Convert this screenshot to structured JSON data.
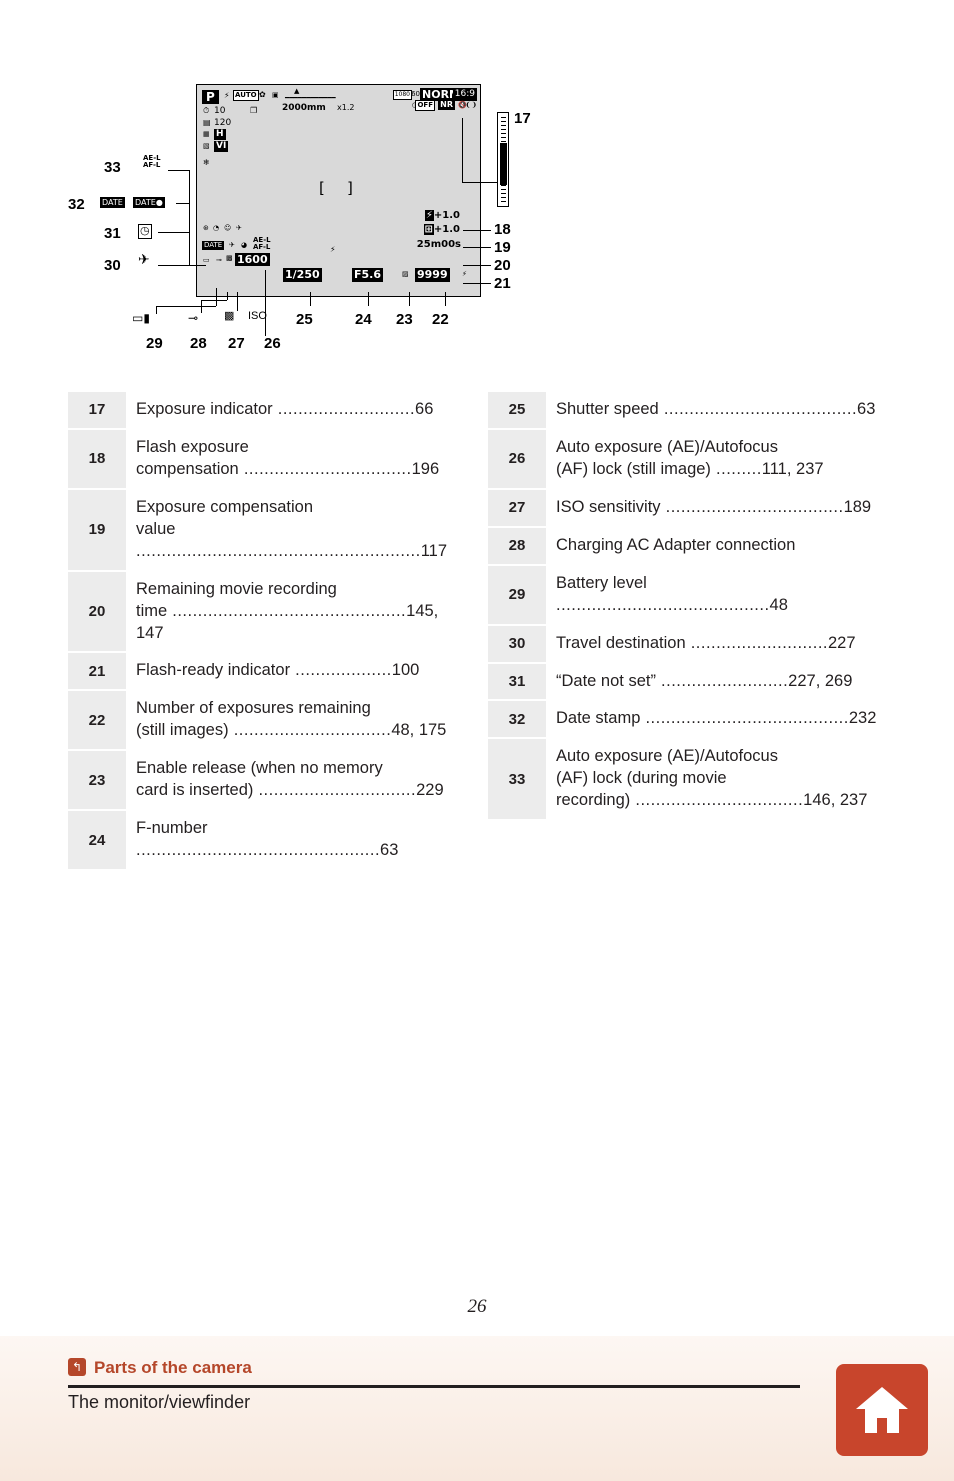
{
  "page": {
    "number": "26",
    "footer_section": "Parts of the camera",
    "footer_subsection": "The monitor/viewfinder",
    "home_icon": "home-icon",
    "back_icon": "back-arrow-icon"
  },
  "diagram": {
    "name": "camera-monitor-display-diagram",
    "callouts_right": [
      "17",
      "18",
      "19",
      "20",
      "21"
    ],
    "callouts_left": [
      "33",
      "32",
      "31",
      "30"
    ],
    "callouts_bottom": [
      "29",
      "28",
      "27",
      "26",
      "25",
      "24",
      "23",
      "22"
    ],
    "display": {
      "mode": "P",
      "flash_mode": "AUTO",
      "self_timer": "10",
      "continuous": "120",
      "hdr": "H",
      "vr": "VI",
      "zoom_focal": "2000mm",
      "zoom_digital": "x1.2",
      "image_quality": "NORM",
      "image_size_icon": "16:9",
      "movie_quality": "1080",
      "frame_rate": "60",
      "noise_reduction": "NR",
      "wind_noise": "OFF",
      "flash_comp": "+1.0",
      "exposure_comp": "+1.0",
      "movie_time": "25m00s",
      "iso_value": "1600",
      "shutter_speed": "1/250",
      "f_number": "F5.6",
      "frames_remaining": "9999",
      "date_stamp": "DATE",
      "ae_af_lock": "AE-L AF-L",
      "battery_icon": "battery-icon",
      "ac_adapter_icon": "ac-adapter-icon",
      "iso_label": "ISO",
      "focus_brackets": "[ ]"
    }
  },
  "legend": {
    "left": [
      {
        "num": "17",
        "text": "Exposure indicator",
        "dots": " ...........................",
        "pages": "66"
      },
      {
        "num": "18",
        "text": "Flash exposure\ncompensation",
        "dots": " .................................",
        "pages": "196"
      },
      {
        "num": "19",
        "text": "Exposure compensation\nvalue",
        "dots": " ........................................................",
        "pages": "117"
      },
      {
        "num": "20",
        "text": "Remaining movie recording\ntime",
        "dots": " ..............................................",
        "pages": "145, 147"
      },
      {
        "num": "21",
        "text": "Flash-ready indicator",
        "dots": " ...................",
        "pages": "100"
      },
      {
        "num": "22",
        "text": "Number of exposures remaining\n(still images)",
        "dots": " ...............................",
        "pages": "48, 175"
      },
      {
        "num": "23",
        "text": "Enable release (when no memory\ncard is inserted)",
        "dots": " ...............................",
        "pages": "229"
      },
      {
        "num": "24",
        "text": "F-number",
        "dots": " ................................................",
        "pages": "63"
      }
    ],
    "right": [
      {
        "num": "25",
        "text": "Shutter speed",
        "dots": " ......................................",
        "pages": "63"
      },
      {
        "num": "26",
        "text": "Auto exposure (AE)/Autofocus\n(AF) lock (still image)",
        "dots": " .........",
        "pages": "111, 237"
      },
      {
        "num": "27",
        "text": "ISO sensitivity",
        "dots": " ...................................",
        "pages": "189"
      },
      {
        "num": "28",
        "text": "Charging AC Adapter connection",
        "dots": "",
        "pages": ""
      },
      {
        "num": "29",
        "text": "Battery level",
        "dots": " ..........................................",
        "pages": "48"
      },
      {
        "num": "30",
        "text": "Travel destination",
        "dots": " ...........................",
        "pages": "227"
      },
      {
        "num": "31",
        "text": "“Date not set”",
        "dots": " .........................",
        "pages": "227, 269"
      },
      {
        "num": "32",
        "text": "Date stamp",
        "dots": " ........................................",
        "pages": "232"
      },
      {
        "num": "33",
        "text": "Auto exposure (AE)/Autofocus\n(AF) lock (during movie\nrecording)",
        "dots": " .................................",
        "pages": "146, 237"
      }
    ]
  },
  "colors": {
    "accent": "#b5472a",
    "home_button": "#c8452c",
    "legend_num_bg": "#ececec",
    "monitor_bg": "#d9d9d9"
  }
}
